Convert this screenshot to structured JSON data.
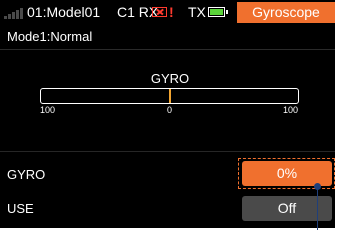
{
  "status_bar": {
    "model_name": "01:Model01",
    "receiver_label": "C1 RX",
    "receiver_alert": "!",
    "transmitter_label": "TX",
    "page_title": "Gyroscope",
    "tx_battery_level": 1.0,
    "colors": {
      "accent": "#f0702e",
      "alert": "#ff3b2f",
      "battery_ok": "#5bd43a"
    }
  },
  "mode_label": "Mode1:Normal",
  "gyro_bar": {
    "title": "GYRO",
    "tick_left": "100",
    "tick_center": "0",
    "tick_right": "100"
  },
  "rows": {
    "gyro": {
      "label": "GYRO",
      "value": "0%"
    },
    "use": {
      "label": "USE",
      "value": "Off"
    }
  }
}
